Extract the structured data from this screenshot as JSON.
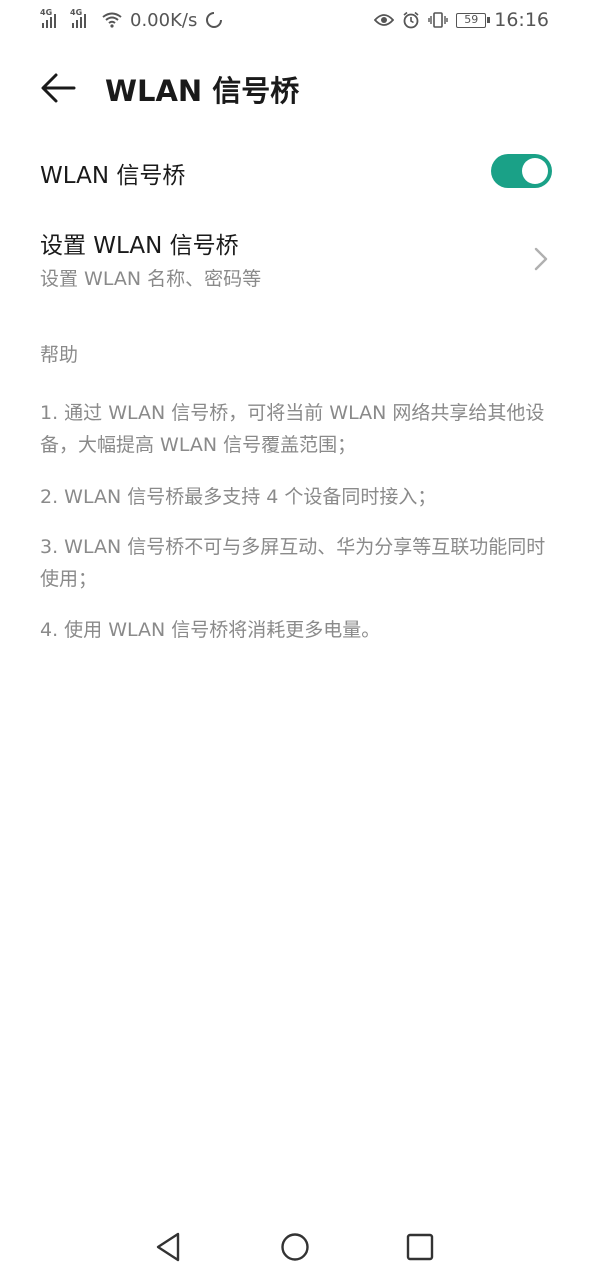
{
  "status_bar": {
    "sim1_tag": "4G",
    "sim2_tag": "4G",
    "net_speed": "0.00K/s",
    "battery": "59",
    "time": "16:16",
    "icons": [
      "signal-icon",
      "signal-icon",
      "wifi-icon",
      "sync-icon",
      "eye-icon",
      "alarm-icon",
      "vibrate-icon",
      "battery-icon"
    ]
  },
  "header": {
    "title": "WLAN 信号桥",
    "back_icon": "arrow-left-icon"
  },
  "toggle_row": {
    "label": "WLAN 信号桥",
    "enabled": true,
    "accent": "#1aa187"
  },
  "setup_row": {
    "title": "设置 WLAN 信号桥",
    "subtitle": "设置 WLAN 名称、密码等",
    "icon": "chevron-right-icon"
  },
  "help": {
    "title": "帮助",
    "items": [
      "1. 通过 WLAN 信号桥，可将当前 WLAN 网络共享给其他设备，大幅提高 WLAN 信号覆盖范围；",
      "2. WLAN 信号桥最多支持 4 个设备同时接入；",
      "3. WLAN 信号桥不可与多屏互动、华为分享等互联功能同时使用；",
      "4. 使用 WLAN 信号桥将消耗更多电量。"
    ]
  },
  "nav_bar": {
    "back": "triangle-back-icon",
    "home": "circle-home-icon",
    "recents": "square-recents-icon"
  }
}
